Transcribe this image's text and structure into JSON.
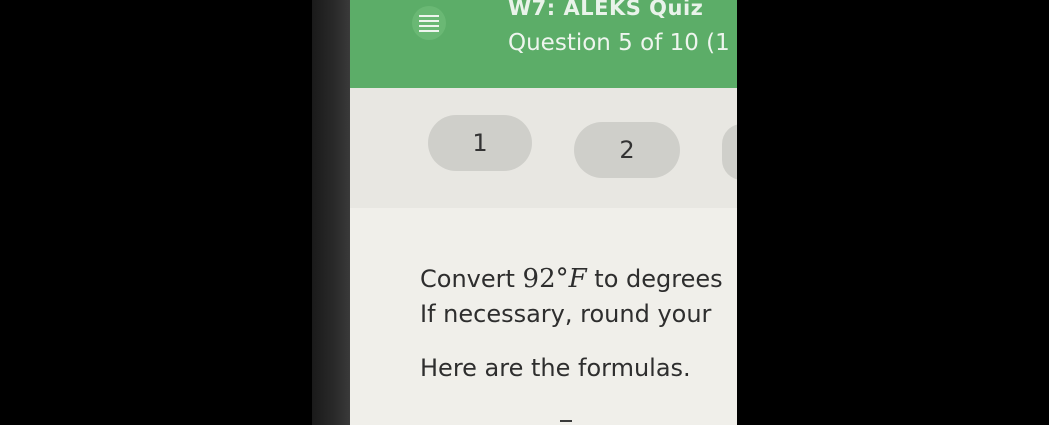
{
  "header": {
    "quiz_title": "W7: ALEKS Quiz",
    "question_counter": "Question 5 of 10 (1",
    "menu_icon": "hamburger-menu-icon"
  },
  "question_nav": {
    "items": [
      {
        "label": "1"
      },
      {
        "label": "2"
      },
      {
        "label": ""
      }
    ]
  },
  "question": {
    "line1_prefix": "Convert ",
    "value": "92",
    "degree": "°",
    "unit": "F",
    "line1_suffix": " to degrees",
    "line2": "If necessary, round your",
    "line3": "Here are the formulas."
  },
  "colors": {
    "header": "#5cad68",
    "background": "#000000",
    "nav_pill": "#cfcfca"
  }
}
